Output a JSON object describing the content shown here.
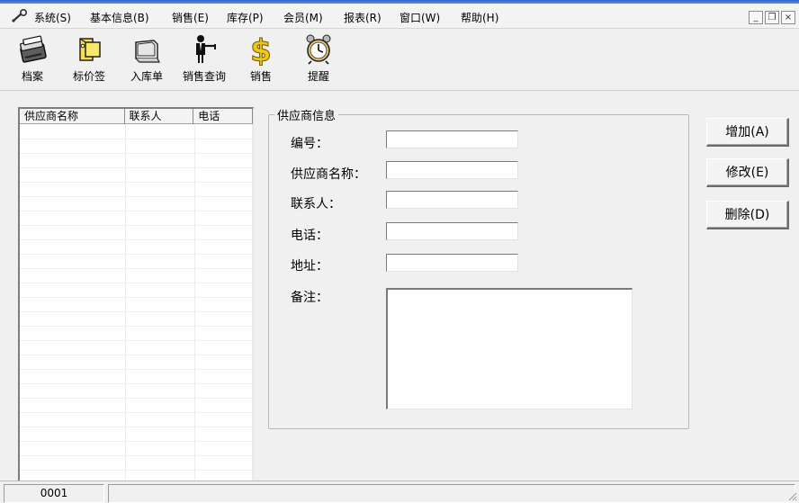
{
  "menubar": {
    "items": [
      {
        "label": "系统(S)"
      },
      {
        "label": "基本信息(B)"
      },
      {
        "label": "销售(E)"
      },
      {
        "label": "库存(P)"
      },
      {
        "label": "会员(M)"
      },
      {
        "label": "报表(R)"
      },
      {
        "label": "窗口(W)"
      },
      {
        "label": "帮助(H)"
      }
    ],
    "mdi_buttons": {
      "minimize": "_",
      "restore": "❐",
      "close": "×"
    }
  },
  "toolbar": {
    "buttons": [
      {
        "label": "档案",
        "icon": "archive-icon"
      },
      {
        "label": "标价签",
        "icon": "price-tag-icon"
      },
      {
        "label": "入库单",
        "icon": "receipt-form-icon"
      },
      {
        "label": "销售查询",
        "icon": "person-cane-icon"
      },
      {
        "label": "销售",
        "icon": "dollar-icon"
      },
      {
        "label": "提醒",
        "icon": "alarm-clock-icon"
      }
    ]
  },
  "supplier_list": {
    "columns": [
      "供应商名称",
      "联系人",
      "电话"
    ],
    "rows": []
  },
  "supplier_info": {
    "group_title": "供应商信息",
    "fields": {
      "id": {
        "label": "编号：",
        "value": ""
      },
      "name": {
        "label": "供应商名称：",
        "value": ""
      },
      "contact": {
        "label": "联系人：",
        "value": ""
      },
      "phone": {
        "label": "电话：",
        "value": ""
      },
      "address": {
        "label": "地址：",
        "value": ""
      },
      "remark": {
        "label": "备注：",
        "value": ""
      }
    }
  },
  "actions": {
    "add": "增加(A)",
    "edit": "修改(E)",
    "delete": "删除(D)"
  },
  "statusbar": {
    "panel1": "0001",
    "panel2": ""
  }
}
